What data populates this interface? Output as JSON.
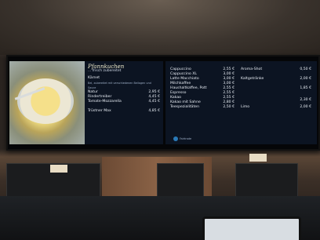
{
  "panel1": {
    "title": "Pfannkuchen",
    "subtitle": "... frisch zubereitet",
    "items": [
      {
        "name": "Kärnet",
        "price": ""
      },
      {
        "name": "Natur",
        "price": "2,95 €"
      },
      {
        "name": "Rindertreiber",
        "price": "4,45 €"
      },
      {
        "name": "Tomate-Mozzarella",
        "price": "4,45 €"
      },
      {
        "name": "Trüstner Max",
        "price": "4,85 €"
      }
    ],
    "note": "Bei, zubereitet mit verschiedenen Beilagen und Sauce"
  },
  "panel2": {
    "left_items": [
      {
        "name": "Cappuccino",
        "price": "2,55 €"
      },
      {
        "name": "Cappuccino XL",
        "price": "3,00 €"
      },
      {
        "name": "Latte Macchiato",
        "price": "3,00 €"
      },
      {
        "name": "Milchkaffee",
        "price": "3,00 €"
      },
      {
        "name": "Haushaltkaffee, Pott",
        "price": "2,55 €"
      },
      {
        "name": "Espresso",
        "price": "2,55 €"
      },
      {
        "name": "Kakao",
        "price": "2,55 €"
      },
      {
        "name": "Kakao mit Sahne",
        "price": "2,80 €"
      },
      {
        "name": "Teespezialitäten",
        "price": "2,50 €"
      }
    ],
    "right_items": [
      {
        "name": "Aroma-Shot",
        "price": "0,50 €"
      },
      {
        "name": "Kaltgetränke",
        "price": "2,00 €"
      },
      {
        "name": "",
        "price": "1,85 €"
      },
      {
        "name": "",
        "price": "2,30 €"
      },
      {
        "name": "Limo",
        "price": "2,00 €"
      }
    ],
    "fairtrade": "Fairtrade"
  }
}
